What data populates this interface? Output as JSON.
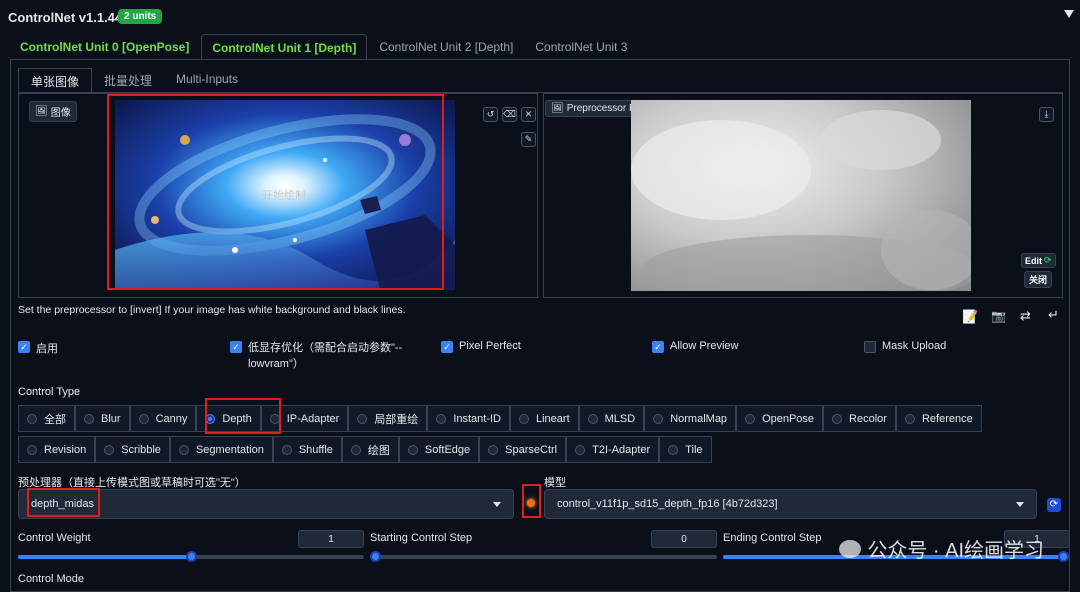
{
  "header": {
    "title": "ControlNet v1.1.445",
    "badge": "2 units"
  },
  "tabs": [
    {
      "label": "ControlNet Unit 0 [OpenPose]"
    },
    {
      "label": "ControlNet Unit 1 [Depth]"
    },
    {
      "label": "ControlNet Unit 2 [Depth]"
    },
    {
      "label": "ControlNet Unit 3"
    }
  ],
  "subtabs": [
    {
      "label": "单张图像"
    },
    {
      "label": "批量处理"
    },
    {
      "label": "Multi-Inputs"
    }
  ],
  "image_panel": {
    "label": "图像",
    "overlay_text": "开始绘制"
  },
  "preview_panel": {
    "label": "Preprocessor Preview",
    "edit_label": "Edit",
    "close_label": "关闭"
  },
  "hint": "Set the preprocessor to [invert] If your image has white background and black lines.",
  "checkboxes": [
    {
      "label": "启用",
      "checked": true
    },
    {
      "label": "低显存优化（需配合启动参数\"--lowvram\"）",
      "checked": true
    },
    {
      "label": "Pixel Perfect",
      "checked": true
    },
    {
      "label": "Allow Preview",
      "checked": true
    },
    {
      "label": "Mask Upload",
      "checked": false
    }
  ],
  "control_type": {
    "label": "Control Type",
    "selected": "Depth",
    "row1": [
      "全部",
      "Blur",
      "Canny",
      "Depth",
      "IP-Adapter",
      "局部重绘",
      "Instant-ID",
      "Lineart",
      "MLSD",
      "NormalMap",
      "OpenPose",
      "Recolor",
      "Reference"
    ],
    "row2": [
      "Revision",
      "Scribble",
      "Segmentation",
      "Shuffle",
      "绘图",
      "SoftEdge",
      "SparseCtrl",
      "T2I-Adapter",
      "Tile"
    ]
  },
  "preprocessor": {
    "label": "预处理器（直接上传模式图或草稿时可选\"无\"）",
    "value": "depth_midas"
  },
  "model": {
    "label": "模型",
    "value": "control_v11f1p_sd15_depth_fp16 [4b72d323]"
  },
  "sliders": {
    "control_weight": {
      "label": "Control Weight",
      "value": "1",
      "fraction": 0.5
    },
    "starting_step": {
      "label": "Starting Control Step",
      "value": "0",
      "fraction": 0.0
    },
    "ending_step": {
      "label": "Ending Control Step",
      "value": "1",
      "fraction": 1.0
    }
  },
  "control_mode": {
    "label": "Control Mode"
  },
  "watermark": {
    "text": "公众号 · AI绘画学习"
  },
  "colors": {
    "accent": "#3b82f6",
    "active_tab": "#6fe04a",
    "highlight": "#e11d1d",
    "badge": "#22a645"
  }
}
